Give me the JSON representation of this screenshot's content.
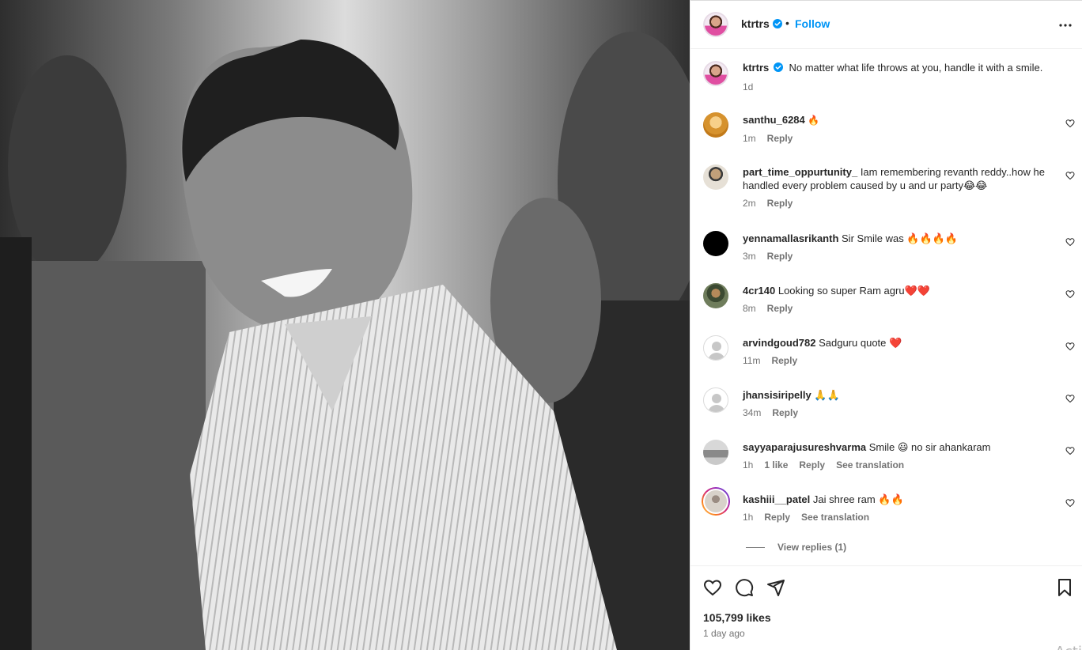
{
  "post": {
    "username": "ktrtrs",
    "separator": "•",
    "follow_label": "Follow",
    "caption": "No matter what life throws at you, handle it with a smile.",
    "caption_time": "1d"
  },
  "comments": [
    {
      "user": "santhu_6284",
      "text": "🔥",
      "time": "1m",
      "likes": "",
      "reply": "Reply",
      "translation": ""
    },
    {
      "user": "part_time_oppurtunity_",
      "text": "Iam remembering revanth reddy..how he handled every problem caused by u and ur party😂😂",
      "time": "2m",
      "likes": "",
      "reply": "Reply",
      "translation": ""
    },
    {
      "user": "yennamallasrikanth",
      "text": "Sir Smile was 🔥🔥🔥🔥",
      "time": "3m",
      "likes": "",
      "reply": "Reply",
      "translation": ""
    },
    {
      "user": "4cr140",
      "text": "Looking so super Ram agru❤️❤️",
      "time": "8m",
      "likes": "",
      "reply": "Reply",
      "translation": ""
    },
    {
      "user": "arvindgoud782",
      "text": "Sadguru quote ❤️",
      "time": "11m",
      "likes": "",
      "reply": "Reply",
      "translation": ""
    },
    {
      "user": "jhansisiripelly",
      "text": "🙏🙏",
      "time": "34m",
      "likes": "",
      "reply": "Reply",
      "translation": ""
    },
    {
      "user": "sayyaparajusureshvarma",
      "text": "Smile 😃 no sir ahankaram",
      "time": "1h",
      "likes": "1 like",
      "reply": "Reply",
      "translation": "See translation"
    },
    {
      "user": "kashiii__patel",
      "text": "Jai shree ram 🔥🔥",
      "time": "1h",
      "likes": "",
      "reply": "Reply",
      "translation": "See translation"
    }
  ],
  "view_replies": "View replies (1)",
  "icons": {
    "verified": "verified-badge-icon",
    "more": "more-options-icon",
    "like": "heart-icon",
    "comment": "comment-icon",
    "share": "share-icon",
    "save": "bookmark-icon"
  },
  "colors": {
    "accent": "#0095f6",
    "verified": "#0095f6",
    "muted": "#737373",
    "text": "#262626"
  },
  "engagement": {
    "likes": "105,799 likes",
    "posted": "1 day ago"
  },
  "overlay": {
    "activate_text": "Acti"
  }
}
